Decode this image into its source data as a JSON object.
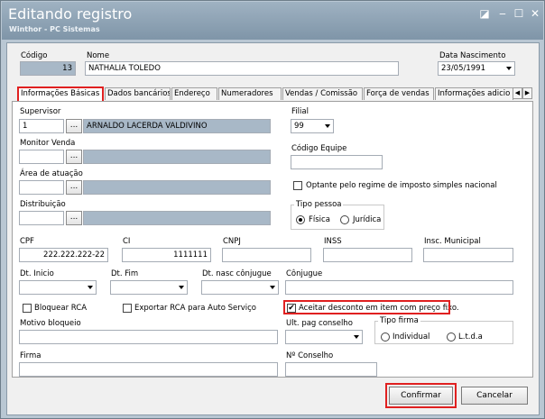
{
  "window": {
    "title": "Editando registro",
    "subtitle": "Winthor - PC Sistemas",
    "controls": [
      "◪",
      "‒",
      "☐",
      "✕"
    ]
  },
  "header": {
    "codigo_label": "Código",
    "codigo_value": "13",
    "nome_label": "Nome",
    "nome_value": "NATHALIA TOLEDO",
    "data_nasc_label": "Data Nascimento",
    "data_nasc_value": "23/05/1991"
  },
  "tabs": [
    {
      "label": "Informações Básicas"
    },
    {
      "label": "Dados bancários"
    },
    {
      "label": "Endereço"
    },
    {
      "label": "Numeradores"
    },
    {
      "label": "Vendas  / Comissão"
    },
    {
      "label": "Força de vendas"
    },
    {
      "label": "Informações adicio"
    }
  ],
  "tab_nav": {
    "left": "◀",
    "right": "▶"
  },
  "form": {
    "supervisor_label": "Supervisor",
    "supervisor_code": "1",
    "supervisor_name": "ARNALDO LACERDA VALDIVINO",
    "dots": "...",
    "monitor_label": "Monitor Venda",
    "area_label": "Área de atuação",
    "distrib_label": "Distribuição",
    "filial_label": "Filial",
    "filial_value": "99",
    "cod_equipe_label": "Código Equipe",
    "optante_label": "Optante pelo regime de imposto simples nacional",
    "tipo_pessoa_label": "Tipo pessoa",
    "fisica_label": "Física",
    "juridica_label": "Jurídica",
    "cpf_label": "CPF",
    "cpf_value": "222.222.222-22",
    "ci_label": "CI",
    "ci_value": "1111111",
    "cnpj_label": "CNPJ",
    "inss_label": "INSS",
    "insc_mun_label": "Insc. Municipal",
    "dt_inicio_label": "Dt. Inicio",
    "dt_fim_label": "Dt. Fim",
    "dt_conj_label": "Dt. nasc cônjugue",
    "conjuge_label": "Cônjugue",
    "bloquear_label": "Bloquear RCA",
    "exportar_label": "Exportar RCA para Auto Serviço",
    "aceitar_label": "Aceitar desconto em item com preço fixo.",
    "motivo_label": "Motivo bloqueio",
    "ult_pag_label": "Ult. pag conselho",
    "tipo_firma_label": "Tipo firma",
    "individual_label": "Individual",
    "ltda_label": "L.t.d.a",
    "firma_label": "Firma",
    "n_conselho_label": "Nº Conselho",
    "check_mark": "✔"
  },
  "buttons": {
    "confirmar": "Confirmar",
    "cancelar": "Cancelar"
  },
  "colors": {
    "highlight": "#e02020",
    "titlebar": "#8a9fb2",
    "readonly": "#a8b8c7"
  }
}
